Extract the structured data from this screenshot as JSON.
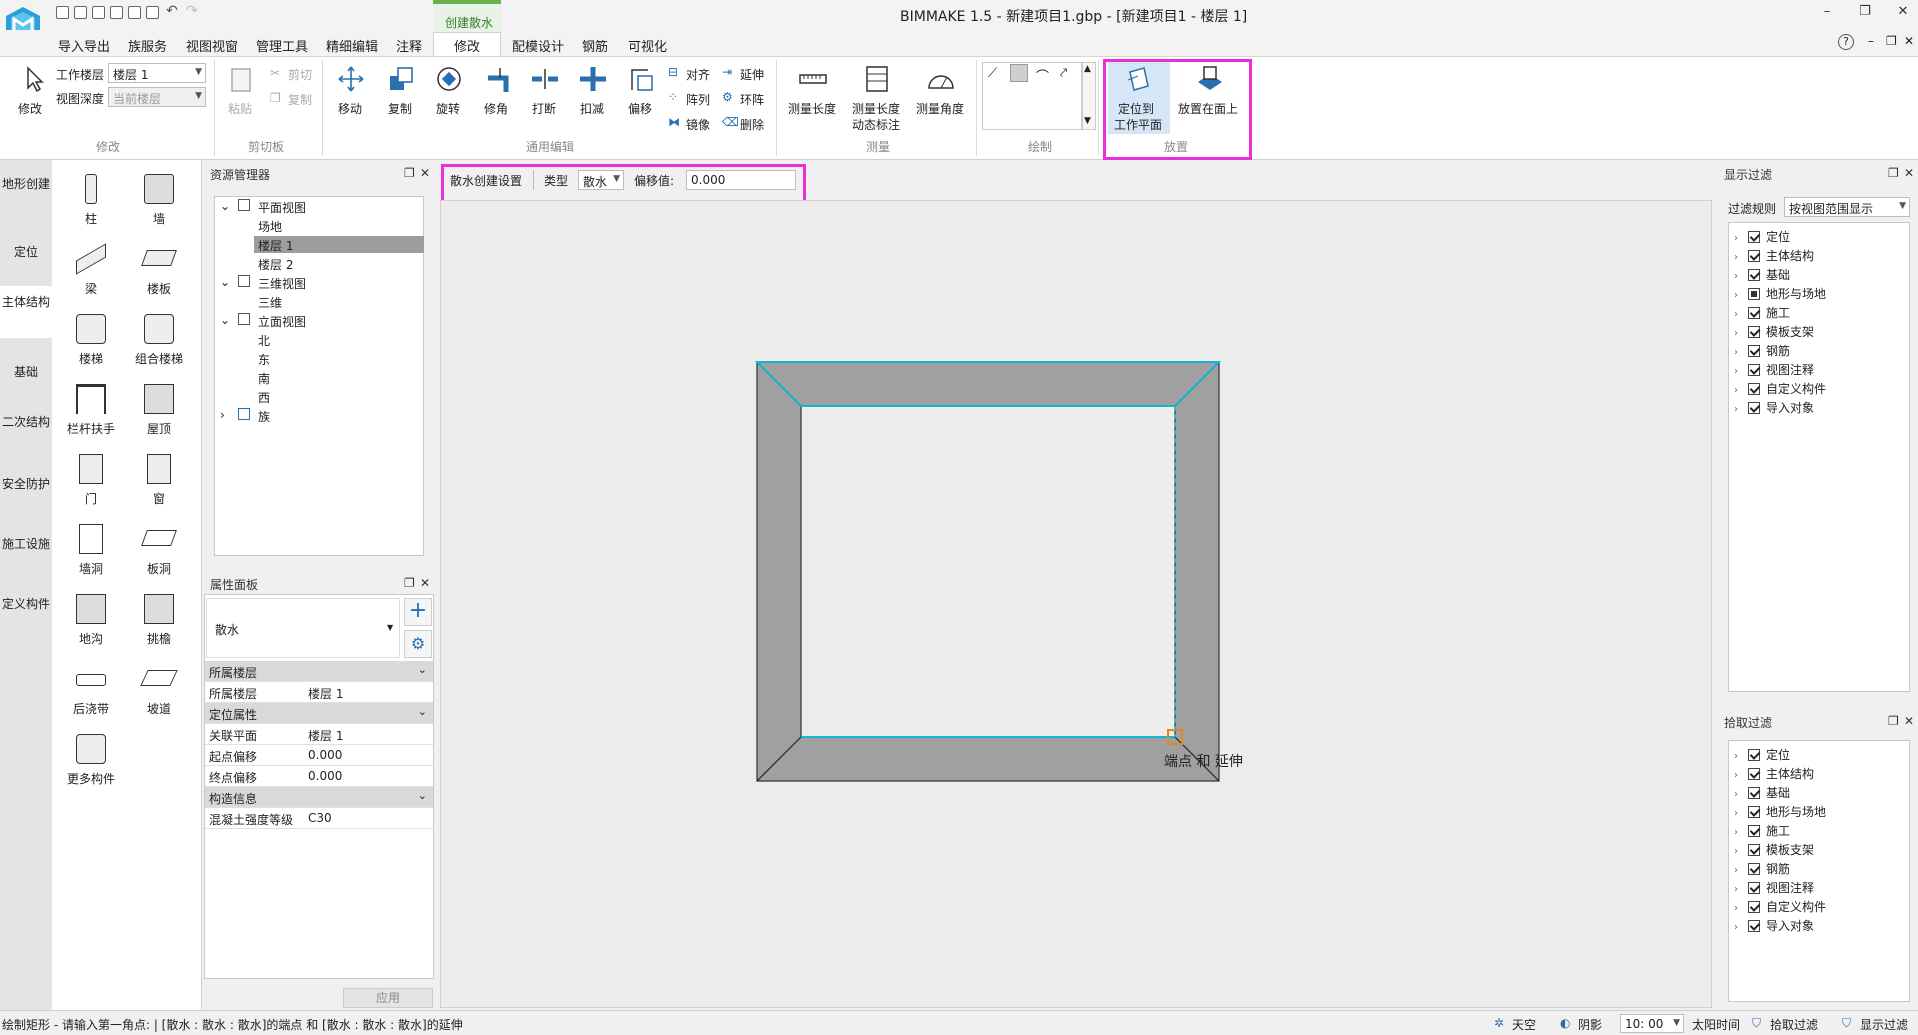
{
  "app": {
    "title": "BIMMAKE 1.5 - 新建项目1.gbp - [新建项目1 - 楼层 1]"
  },
  "window_buttons": {
    "minimize": "–",
    "restore": "❐",
    "close": "✕",
    "help": "?"
  },
  "menu": {
    "context_tab": "创建散水",
    "items": [
      "导入导出",
      "族服务",
      "视图视窗",
      "管理工具",
      "精细编辑",
      "注释",
      "修改",
      "配模设计",
      "钢筋",
      "可视化"
    ],
    "active": "修改"
  },
  "ribbon": {
    "modify": {
      "label": "修改",
      "work_floor_label": "工作楼层",
      "work_floor_value": "楼层 1",
      "view_depth_label": "视图深度",
      "view_depth_value": "当前楼层",
      "group": "修改"
    },
    "clipboard": {
      "paste": "粘贴",
      "cut": "剪切",
      "copy": "复制",
      "group": "剪切板"
    },
    "edit": {
      "move": "移动",
      "copy": "复制",
      "rotate": "旋转",
      "trim": "修角",
      "break": "打断",
      "deduct": "扣减",
      "offset": "偏移",
      "align": "对齐",
      "array": "阵列",
      "mirror": "镜像",
      "extend": "延伸",
      "ring": "环阵",
      "delete": "删除",
      "group": "通用编辑"
    },
    "measure": {
      "length": "测量长度",
      "dynamic_line1": "测量长度",
      "dynamic_line2": "动态标注",
      "angle": "测量角度",
      "group": "测量"
    },
    "draw": {
      "group": "绘制"
    },
    "place": {
      "workplane_line1": "定位到",
      "workplane_line2": "工作平面",
      "on_face": "放置在面上",
      "group": "放置"
    }
  },
  "left_tabs": [
    "地形创建",
    "定位",
    "主体结构",
    "基础",
    "二次结构",
    "安全防护",
    "施工设施",
    "定义构件"
  ],
  "left_tabs_selected": "主体结构",
  "palette": [
    "柱",
    "墙",
    "梁",
    "楼板",
    "楼梯",
    "组合楼梯",
    "栏杆扶手",
    "屋顶",
    "门",
    "窗",
    "墙洞",
    "板洞",
    "地沟",
    "挑檐",
    "后浇带",
    "坡道",
    "更多构件"
  ],
  "resource_manager": {
    "title": "资源管理器",
    "tree": [
      "平面视图",
      "场地",
      "楼层 1",
      "楼层 2",
      "三维视图",
      "三维",
      "立面视图",
      "北",
      "东",
      "南",
      "西",
      "族"
    ]
  },
  "properties": {
    "title": "属性面板",
    "type_value": "散水",
    "rows": [
      {
        "key": "所属楼层",
        "value": ""
      },
      {
        "key": "所属楼层",
        "value": "楼层 1"
      },
      {
        "key": "定位属性",
        "value": ""
      },
      {
        "key": "关联平面",
        "value": "楼层 1"
      },
      {
        "key": "起点偏移",
        "value": "0.000"
      },
      {
        "key": "终点偏移",
        "value": "0.000"
      },
      {
        "key": "构造信息",
        "value": ""
      },
      {
        "key": "混凝土强度等级",
        "value": "C30"
      }
    ],
    "apply": "应用"
  },
  "options_bar": {
    "settings": "散水创建设置",
    "type_label": "类型",
    "type_value": "散水",
    "offset_label": "偏移值:",
    "offset_value": "0.000"
  },
  "canvas": {
    "snap_label": "端点 和 延伸"
  },
  "display_filter": {
    "title": "显示过滤",
    "rule_label": "过滤规则",
    "rule_value": "按视图范围显示",
    "items": [
      "定位",
      "主体结构",
      "基础",
      "地形与场地",
      "施工",
      "模板支架",
      "钢筋",
      "视图注释",
      "自定义构件",
      "导入对象"
    ]
  },
  "pick_filter": {
    "title": "拾取过滤",
    "items": [
      "定位",
      "主体结构",
      "基础",
      "地形与场地",
      "施工",
      "模板支架",
      "钢筋",
      "视图注释",
      "自定义构件",
      "导入对象"
    ]
  },
  "status": {
    "message": "绘制矩形 - 请输入第一角点: | [散水 : 散水 : 散水]的端点 和 [散水 : 散水 : 散水]的延伸",
    "sky": "天空",
    "shadow": "阴影",
    "time": "10: 00",
    "sun_time": "太阳时间",
    "pick_filter": "拾取过滤",
    "display_filter": "显示过滤"
  },
  "colors": {
    "highlight": "#e830d8",
    "accent": "#00b8d9",
    "snap": "#e08a1e",
    "slab": "#9e9e9e"
  }
}
